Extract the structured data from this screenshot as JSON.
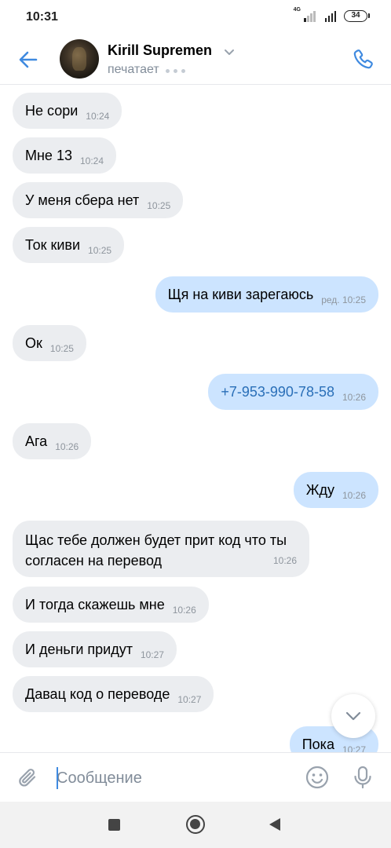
{
  "status_bar": {
    "time": "10:31",
    "network": "4G",
    "battery": "34"
  },
  "header": {
    "contact_name": "Kirill Supremen",
    "status": "печатает",
    "icons": {
      "back": "arrow-left-icon",
      "call": "phone-icon",
      "chevron": "chevron-down-icon"
    }
  },
  "messages": [
    {
      "dir": "in",
      "text": "Не сори",
      "time": "10:24"
    },
    {
      "dir": "in",
      "text": "Мне 13",
      "time": "10:24"
    },
    {
      "dir": "in",
      "text": "У меня сбера нет",
      "time": "10:25"
    },
    {
      "dir": "in",
      "text": "Ток киви",
      "time": "10:25"
    },
    {
      "dir": "out",
      "text": "Щя на киви зарегаюсь",
      "time": "ред. 10:25"
    },
    {
      "dir": "in",
      "text": "Ок",
      "time": "10:25"
    },
    {
      "dir": "out",
      "text": "+7-953-990-78-58",
      "time": "10:26"
    },
    {
      "dir": "in",
      "text": "Ага",
      "time": "10:26"
    },
    {
      "dir": "out",
      "text": "Жду",
      "time": "10:26"
    },
    {
      "dir": "in",
      "text": "Щас тебе должен будет прит код что ты согласен на перевод",
      "time": "10:26"
    },
    {
      "dir": "in",
      "text": "И тогда скажешь мне",
      "time": "10:26"
    },
    {
      "dir": "in",
      "text": "И деньги придут",
      "time": "10:27"
    },
    {
      "dir": "in",
      "text": "Давац код о переводе",
      "time": "10:27"
    },
    {
      "dir": "out",
      "text": "Пока",
      "time": "10:27"
    }
  ],
  "composer": {
    "placeholder": "Сообщение",
    "icons": {
      "attach": "paperclip-icon",
      "emoji": "smile-icon",
      "voice": "microphone-icon"
    }
  },
  "colors": {
    "accent": "#3f8ae0",
    "incoming_bubble": "#ebedf0",
    "outgoing_bubble": "#cce4ff",
    "link": "#2a6fb8"
  }
}
